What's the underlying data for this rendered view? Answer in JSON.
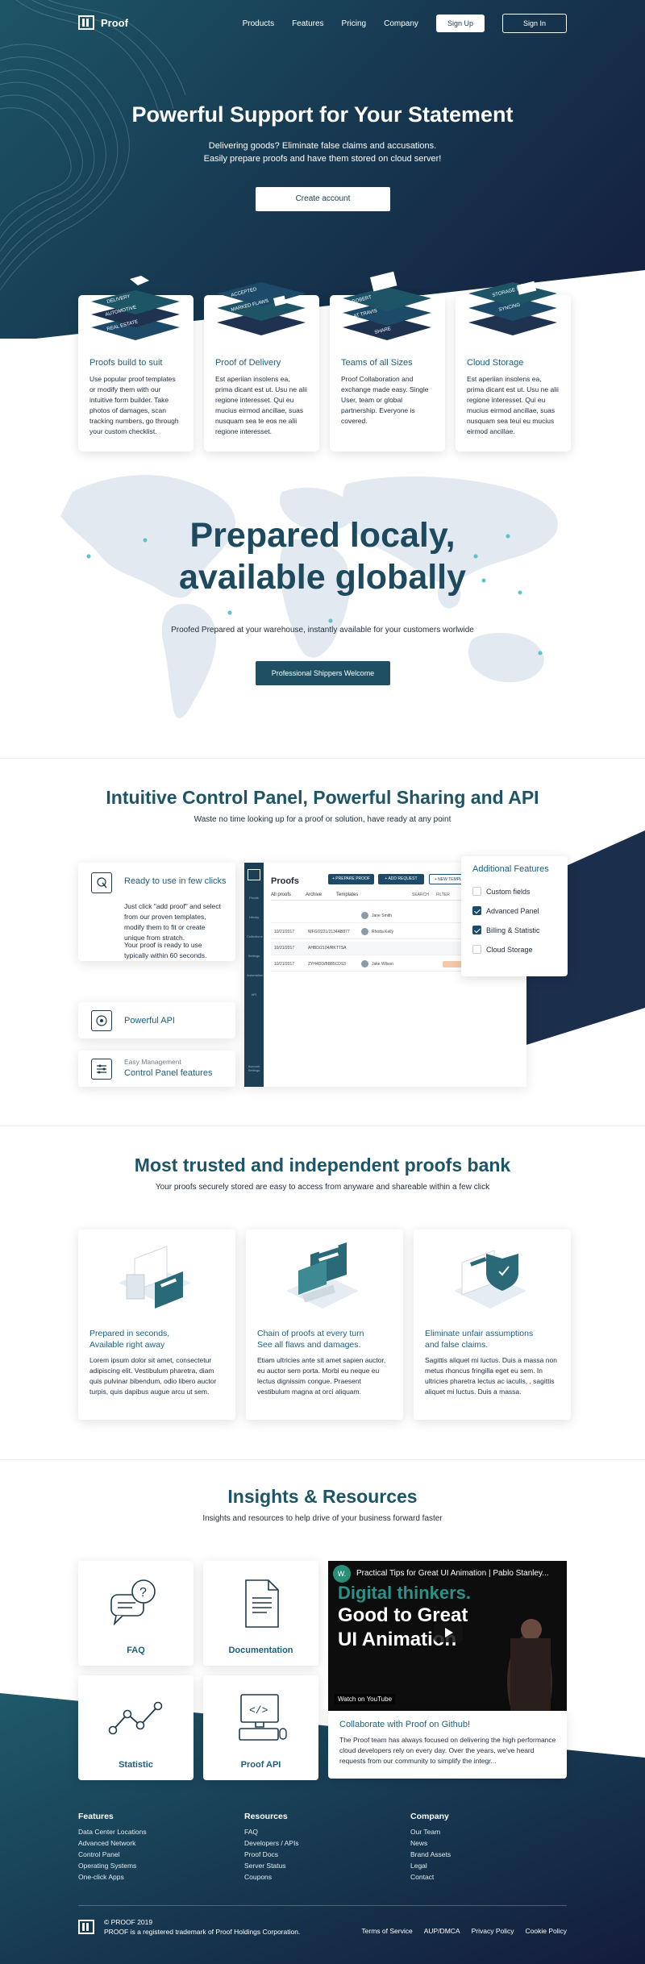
{
  "nav": {
    "brand": "Proof",
    "links": [
      "Products",
      "Features",
      "Pricing",
      "Company"
    ],
    "signup": "Sign Up",
    "signin": "Sign In"
  },
  "hero": {
    "title": "Powerful Support for Your Statement",
    "subtitle_line1": "Delivering goods? Eliminate false claims and accusations.",
    "subtitle_line2": "Easily prepare proofs and have them stored on cloud server!",
    "cta": "Create account"
  },
  "features": [
    {
      "title": "Proofs build to suit",
      "text": "Use popular proof templates or modify them with our intuitive form builder. Take photos of damages, scan tracking numbers, go through your custom checklist.",
      "art_labels": [
        "DELIVERY",
        "AUTOMOTIVE",
        "REAL ESTATE"
      ]
    },
    {
      "title": "Proof of Delivery",
      "text": "Est aperiian insolens ea, prima dicant est ut. Usu ne alii regione interesset. Qui eu mucius eirmod ancillae, suas nusquam sea te eos ne alii regione interesset.",
      "art_labels": [
        "ACCEPTED",
        "MARKED FLAWS",
        ""
      ]
    },
    {
      "title": "Teams of all Sizes",
      "text": "Proof Collaboration and exchange made easy. Single User, team or global partnership. Everyone is covered.",
      "art_labels": [
        "ROBERT",
        "AT TRAVIS",
        "SHARE"
      ]
    },
    {
      "title": "Cloud Storage",
      "text": "Est aperiian insolens ea, prima dicant est ut. Usu ne alii regione interesset. Qui eu mucius eirmod ancillae, suas nusquam sea teui eu mucius eirmod ancillae.",
      "art_labels": [
        "STORAGE SERVER",
        "SYNCING",
        ""
      ]
    }
  ],
  "prepared": {
    "title_line1": "Prepared localy,",
    "title_line2": "available globally",
    "subtitle": "Proofed Prepared at your warehouse, instantly available for your customers worlwide",
    "cta": "Professional Shippers Welcome"
  },
  "control_panel": {
    "title": "Intuitive Control Panel, Powerful Sharing and API",
    "subtitle": "Waste no time looking up for a proof or solution, have ready at any point",
    "card1": {
      "title": "Ready to use in few clicks",
      "text1": "Just click \"add proof\" and select from our proven templates, modify them to fit or create unique from stratch.",
      "text2": "Your proof is ready to use typically within 60 seconds."
    },
    "card2": {
      "title": "Powerful API"
    },
    "card3": {
      "small": "Easy Management",
      "title": "Control Panel features"
    },
    "dashboard": {
      "title": "Proofs",
      "buttons": [
        "+ PREPARE PROOF",
        "+ ADD REQUEST",
        "+ NEW TEMPLATE"
      ],
      "tabs": [
        "All proofs",
        "Archive",
        "Templates"
      ],
      "tools": [
        "SEARCH",
        "FILTER"
      ],
      "sidebar": [
        "Proofs",
        "Library",
        "Collections",
        "Settings",
        "Automation",
        "API"
      ],
      "sidebar_bottom": "Account Settings",
      "rows": [
        {
          "date": "",
          "id": "",
          "name": "Jane Smith",
          "status": ""
        },
        {
          "date": "10/21/2017",
          "id": "WFG/2221/2134AB877",
          "name": "Rhoda Kelly",
          "status": ""
        },
        {
          "date": "10/21/2017",
          "id": "AHBD/2104/RKTTSA",
          "name": "",
          "status": ""
        },
        {
          "date": "10/21/2017",
          "id": "ZYH4DD/BB85CDS3",
          "name": "Jake Wilson",
          "status": ""
        }
      ]
    },
    "additional": {
      "title": "Additional Features",
      "items": [
        {
          "label": "Custom fields",
          "checked": false
        },
        {
          "label": "Advanced Panel",
          "checked": true
        },
        {
          "label": "Billing & Statistic",
          "checked": true
        },
        {
          "label": "Cloud Storage",
          "checked": false
        }
      ]
    }
  },
  "trusted": {
    "title": "Most trusted and independent proofs bank",
    "subtitle": "Your proofs securely stored are easy to access from anyware and shareable within a few click",
    "cards": [
      {
        "title_line1": "Prepared in seconds,",
        "title_line2": "Available right away",
        "text": "Lorem ipsum dolor sit amet, consectetur adipiscing elit. Vestibulum pharetra, diam quis pulvinar bibendum, odio libero auctor turpis, quis dapibus augue arcu ut sem."
      },
      {
        "title_line1": "Chain of proofs at every turn",
        "title_line2": "See all flaws and damages.",
        "text": "Etiam ultricies ante sit amet sapien auctor, eu auctor sem porta. Morbi eu neque eu lectus dignissim congue. Praesent vestibulum magna at orci aliquam."
      },
      {
        "title_line1": "Eliminate unfair assumptions",
        "title_line2": "and false claims.",
        "text": "Sagittis aliquet mi luctus. Duis a massa non metus rhoncus fringilla eget eu sem. In ultricies pharetra lectus ac iaculis, , sagittis aliquet mi luctus. Duis a massa."
      }
    ]
  },
  "insights": {
    "title": "Insights & Resources",
    "subtitle": "Insights and resources to help drive of your business forward faster",
    "cards": [
      "FAQ",
      "Documentation",
      "Statistic",
      "Proof API"
    ],
    "video": {
      "channel_initial": "W.",
      "title": "Practical Tips for Great UI Animation | Pablo Stanley...",
      "big1": "Digital thinkers.",
      "big2_line1": "Good to Great",
      "big2_line2": "UI Animation",
      "watch": "Watch on  YouTube"
    },
    "github": {
      "title": "Collaborate with Proof on Github!",
      "text": "The Proof team has always focused on delivering the high performance cloud developers rely on every day. Over the years, we've heard requests from our community to simplify the integr..."
    }
  },
  "footer": {
    "columns": [
      {
        "title": "Features",
        "items": [
          "Data Center Locations",
          "Advanced Network",
          "Control Panel",
          "Operating Systems",
          "One-click Apps"
        ]
      },
      {
        "title": "Resources",
        "items": [
          "FAQ",
          "Developers / APIs",
          "Proof Docs",
          "Server Status",
          "Coupons"
        ]
      },
      {
        "title": "Company",
        "items": [
          "Our Team",
          "News",
          "Brand Assets",
          "Legal",
          "Contact"
        ]
      }
    ],
    "copyright": "© PROOF 2019",
    "trademark": "PROOF is a registered trademark of Proof Holdings Corporation.",
    "links": [
      "Terms of Service",
      "AUP/DMCA",
      "Privacy Policy",
      "Cookie Policy"
    ]
  },
  "colors": {
    "hero_dark": "#141d3c",
    "hero_teal": "#1d5566",
    "accent": "#1d5f7a",
    "button_dark": "#1e4f63"
  }
}
